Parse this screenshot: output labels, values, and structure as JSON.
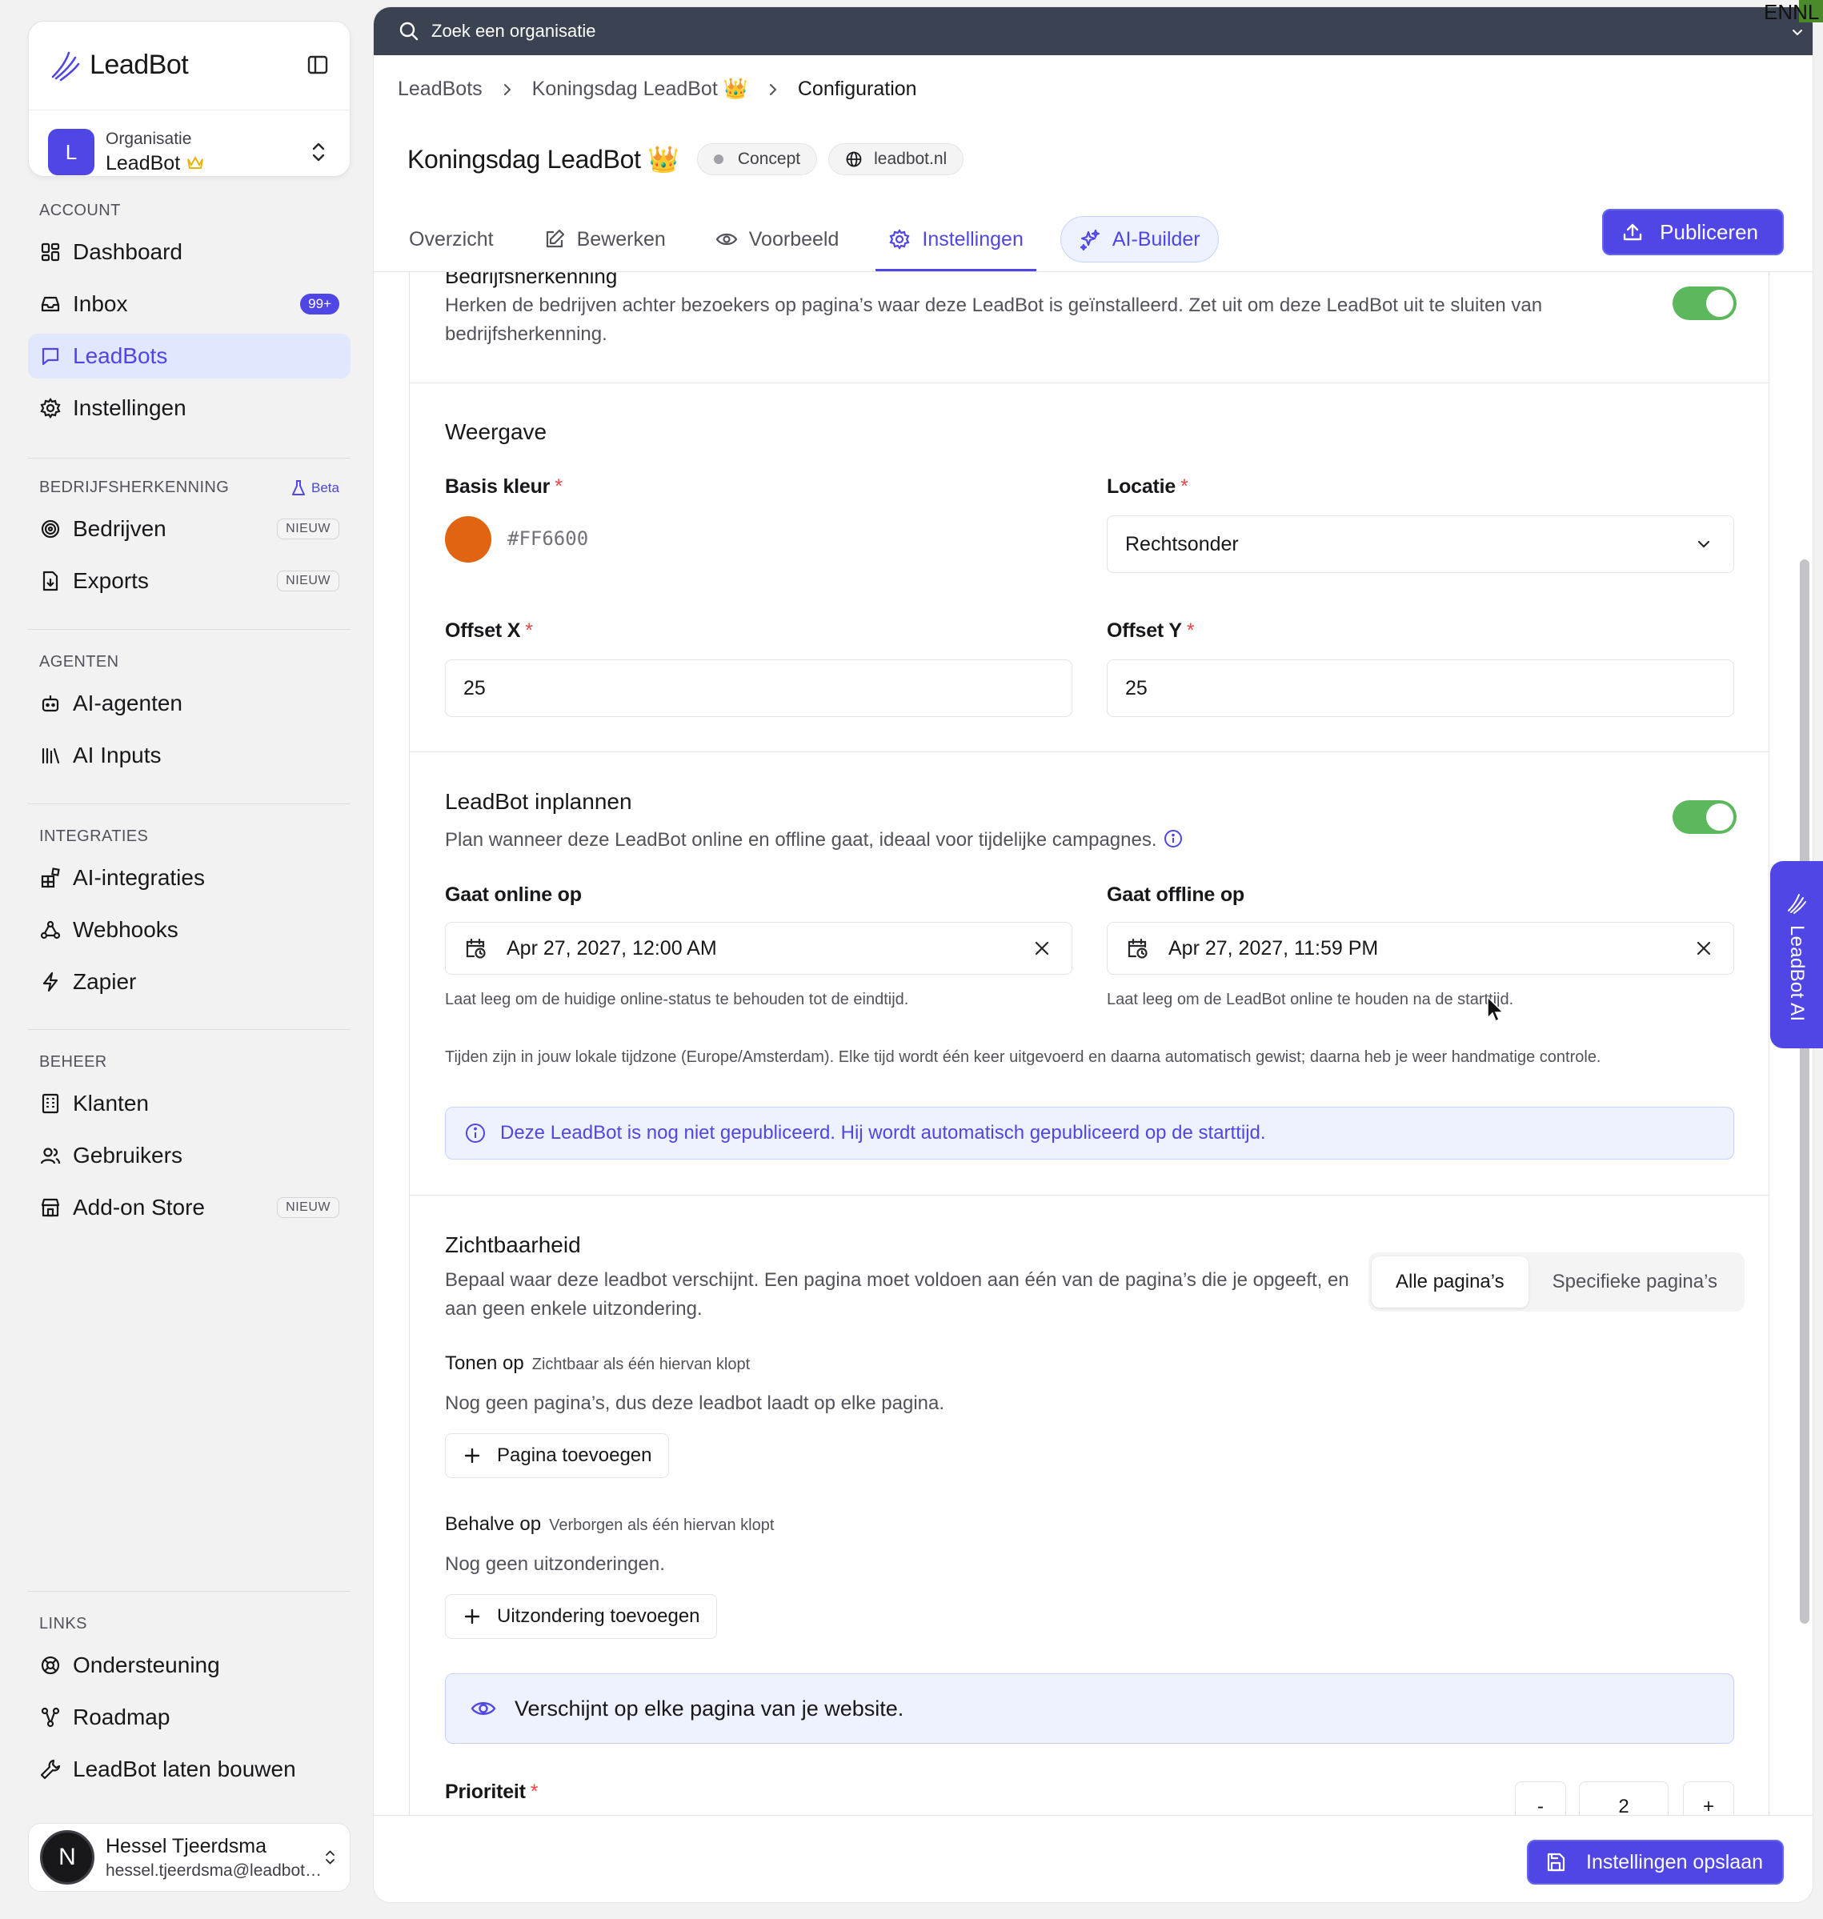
{
  "sidebar": {
    "brand": "LeadBot",
    "org": {
      "initial": "L",
      "label": "Organisatie",
      "name": "LeadBot"
    },
    "sections": {
      "account": "ACCOUNT",
      "bedrijf": "BEDRIJFSHERKENNING",
      "beta": "Beta",
      "agenten": "AGENTEN",
      "integraties": "INTEGRATIES",
      "beheer": "BEHEER",
      "links": "LINKS"
    },
    "items": {
      "dashboard": "Dashboard",
      "inbox": "Inbox",
      "inbox_badge": "99+",
      "leadbots": "LeadBots",
      "instellingen": "Instellingen",
      "bedrijven": "Bedrijven",
      "exports": "Exports",
      "new_badge": "NIEUW",
      "ai_agenten": "AI-agenten",
      "ai_inputs": "AI Inputs",
      "ai_integraties": "AI-integraties",
      "webhooks": "Webhooks",
      "zapier": "Zapier",
      "klanten": "Klanten",
      "gebruikers": "Gebruikers",
      "addon": "Add-on Store",
      "ondersteuning": "Ondersteuning",
      "roadmap": "Roadmap",
      "laten_bouwen": "LeadBot laten bouwen"
    },
    "user": {
      "initial": "N",
      "name": "Hessel Tjeerdsma",
      "email": "hessel.tjeerdsma@leadbot.nl"
    }
  },
  "topbar": {
    "search_placeholder": "Zoek een organisatie",
    "lang": "ENNL"
  },
  "breadcrumb": {
    "b1": "LeadBots",
    "b2": "Koningsdag LeadBot 👑",
    "b3": "Configuration"
  },
  "header": {
    "title": "Koningsdag LeadBot 👑",
    "status": "Concept",
    "domain": "leadbot.nl"
  },
  "tabs": {
    "overzicht": "Overzicht",
    "bewerken": "Bewerken",
    "voorbeeld": "Voorbeeld",
    "instellingen": "Instellingen",
    "ai_builder": "AI-Builder",
    "publish": "Publiceren"
  },
  "company": {
    "title": "Bedrijfsherkenning",
    "desc1": "Herken de bedrijven achter bezoekers op pagina’s waar deze LeadBot is geïnstalleerd. Zet uit om deze LeadBot uit te sluiten van",
    "desc2": "bedrijfsherkenning."
  },
  "display": {
    "title": "Weergave",
    "color_label": "Basis kleur",
    "color_value": "#FF6600",
    "location_label": "Locatie",
    "location_value": "Rechtsonder",
    "offset_x_label": "Offset X",
    "offset_x_value": "25",
    "offset_y_label": "Offset Y",
    "offset_y_value": "25",
    "req": "*"
  },
  "schedule": {
    "title": "LeadBot inplannen",
    "desc": "Plan wanneer deze LeadBot online en offline gaat, ideaal voor tijdelijke campagnes.",
    "online_label": "Gaat online op",
    "online_value": "Apr 27, 2027, 12:00 AM",
    "online_hint": "Laat leeg om de huidige online-status te behouden tot de eindtijd.",
    "offline_label": "Gaat offline op",
    "offline_value": "Apr 27, 2027, 11:59 PM",
    "offline_hint": "Laat leeg om de LeadBot online te houden na de starttijd.",
    "tz_note": "Tijden zijn in jouw lokale tijdzone (Europe/Amsterdam). Elke tijd wordt één keer uitgevoerd en daarna automatisch gewist; daarna heb je weer handmatige controle.",
    "info": "Deze LeadBot is nog niet gepubliceerd. Hij wordt automatisch gepubliceerd op de starttijd."
  },
  "visibility": {
    "title": "Zichtbaarheid",
    "desc1": "Bepaal waar deze leadbot verschijnt. Een pagina moet voldoen aan één van de pagina’s die je opgeeft, en",
    "desc2": "aan geen enkele uitzondering.",
    "opt_all": "Alle pagina’s",
    "opt_specific": "Specifieke pagina’s",
    "show_label": "Tonen op",
    "show_sub": "Zichtbaar als één hiervan klopt",
    "show_empty": "Nog geen pagina’s, dus deze leadbot laadt op elke pagina.",
    "add_page": "Pagina toevoegen",
    "except_label": "Behalve op",
    "except_sub": "Verborgen als één hiervan klopt",
    "except_empty": "Nog geen uitzonderingen.",
    "add_except": "Uitzondering toevoegen",
    "summary": "Verschijnt op elke pagina van je website.",
    "priority_label": "Prioriteit",
    "priority_value": "2",
    "minus": "-",
    "plus": "+"
  },
  "footer": {
    "save": "Instellingen opslaan"
  },
  "side_tab": "LeadBot AI",
  "colors": {
    "accent": "#4f46e5",
    "toggle": "#5cb85c",
    "base_color": "#FF6600"
  }
}
